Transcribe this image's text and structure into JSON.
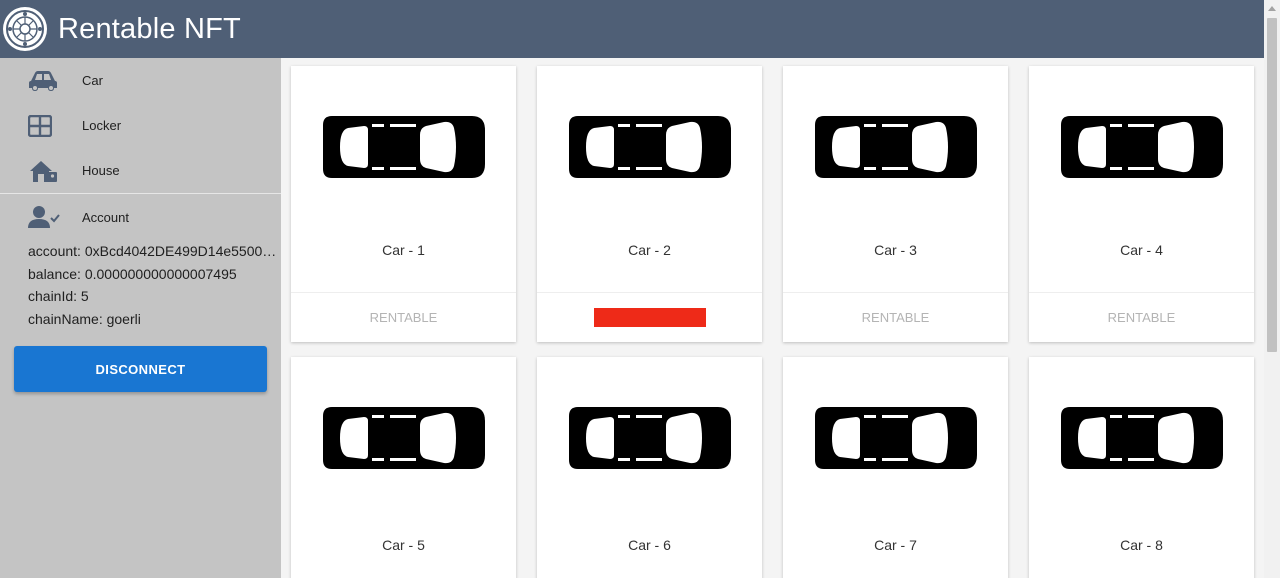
{
  "app": {
    "title": "Rentable NFT",
    "logo_icon": "nft-logo-icon"
  },
  "sidebar": {
    "items": [
      {
        "label": "Car",
        "icon": "car-icon"
      },
      {
        "label": "Locker",
        "icon": "locker-icon"
      },
      {
        "label": "House",
        "icon": "house-icon"
      }
    ],
    "account": {
      "label": "Account",
      "icon": "account-icon",
      "account_line": "account: 0xBcd4042DE499D14e55001CcbB24a551F3b954096",
      "balance_line": "balance: 0.000000000000007495",
      "chain_id_line": "chainId: 5",
      "chain_name_line": "chainName: goerli"
    },
    "disconnect_label": "DISCONNECT"
  },
  "cards": [
    {
      "title": "Car - 1",
      "action": "RENTABLE"
    },
    {
      "title": "Car - 2",
      "action": ""
    },
    {
      "title": "Car - 3",
      "action": "RENTABLE"
    },
    {
      "title": "Car - 4",
      "action": "RENTABLE"
    },
    {
      "title": "Car - 5",
      "action": ""
    },
    {
      "title": "Car - 6",
      "action": ""
    },
    {
      "title": "Car - 7",
      "action": ""
    },
    {
      "title": "Car - 8",
      "action": ""
    }
  ],
  "colors": {
    "appbar": "#4f5f76",
    "sidebar": "#c4c4c4",
    "accent": "#1976d2",
    "redaction": "#ee2a18"
  }
}
